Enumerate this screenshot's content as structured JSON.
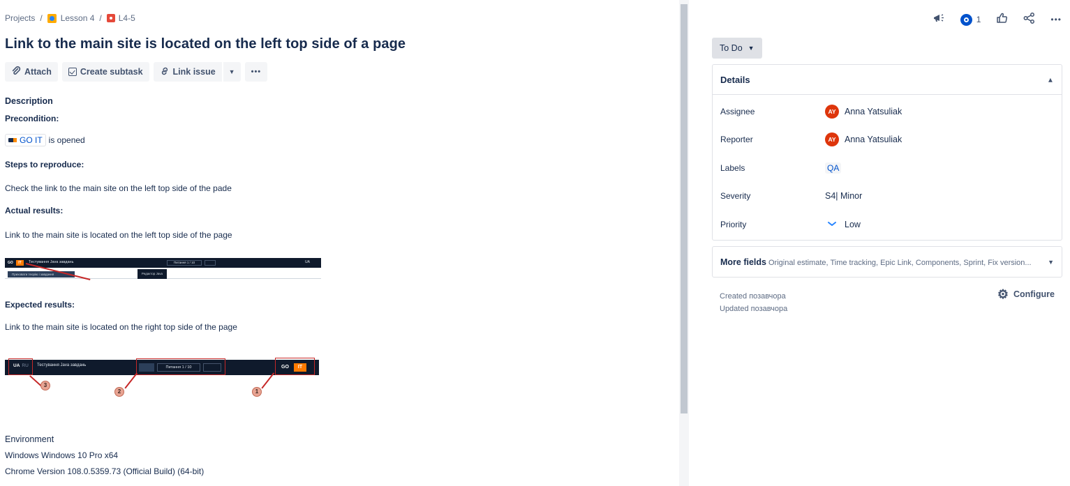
{
  "breadcrumb": {
    "root": "Projects",
    "separator": "/",
    "project": "Lesson 4",
    "issue_key": "L4-5"
  },
  "issue": {
    "title": "Link to the main site is located on the left top side of a page"
  },
  "toolbar": {
    "attach": "Attach",
    "create_subtask": "Create subtask",
    "link_issue": "Link issue",
    "more": "•••"
  },
  "description": {
    "heading": "Description",
    "precondition_label": "Precondition:",
    "precondition_link": "GO IT",
    "precondition_suffix": "is opened",
    "steps_label": "Steps to reproduce:",
    "steps_text": "Check the link to the main site on the left top side of the pade",
    "actual_label": "Actual results:",
    "actual_text": "Link to the main site is located on the left top side of the page",
    "expected_label": "Expected results:",
    "expected_text": "Link to the main site is located on the right top side of the page"
  },
  "screenshot1": {
    "logo_go": "GO",
    "logo_it": "IT",
    "title": "Тестування Java завдань",
    "nav": "Питання 1 / 10",
    "lang": "UA",
    "btn_left": "Приховати теорію і завдання",
    "btn_right": "Редактор Java"
  },
  "screenshot2": {
    "lang_ua": "UA",
    "lang_ru": "RU",
    "title": "Тестування Java завдань",
    "nav": "Питання 1 / 10",
    "logo_go": "GO",
    "logo_it": "IT",
    "marker1": "1",
    "marker2": "2",
    "marker3": "3"
  },
  "environment": {
    "heading": "Environment",
    "line1": "Windows Windows 10 Pro x64",
    "line2": "Chrome Version 108.0.5359.73 (Official Build) (64-bit)"
  },
  "header_actions": {
    "watch_count": "1",
    "more": "•••"
  },
  "status": {
    "label": "To Do"
  },
  "details": {
    "heading": "Details",
    "fields": [
      {
        "label": "Assignee",
        "value": "Anna Yatsuliak",
        "avatar": "AY"
      },
      {
        "label": "Reporter",
        "value": "Anna Yatsuliak",
        "avatar": "AY"
      },
      {
        "label": "Labels",
        "value": "QA"
      },
      {
        "label": "Severity",
        "value": "S4| Minor"
      },
      {
        "label": "Priority",
        "value": "Low"
      }
    ]
  },
  "more_fields": {
    "title": "More fields",
    "summary": "Original estimate, Time tracking, Epic Link, Components, Sprint, Fix version..."
  },
  "meta": {
    "created": "Created позавчора",
    "updated": "Updated позавчора",
    "configure": "Configure"
  },
  "colors": {
    "link": "#0052cc",
    "text": "#172b4d",
    "avatar": "#de350b",
    "priority_low": "#2684ff"
  }
}
